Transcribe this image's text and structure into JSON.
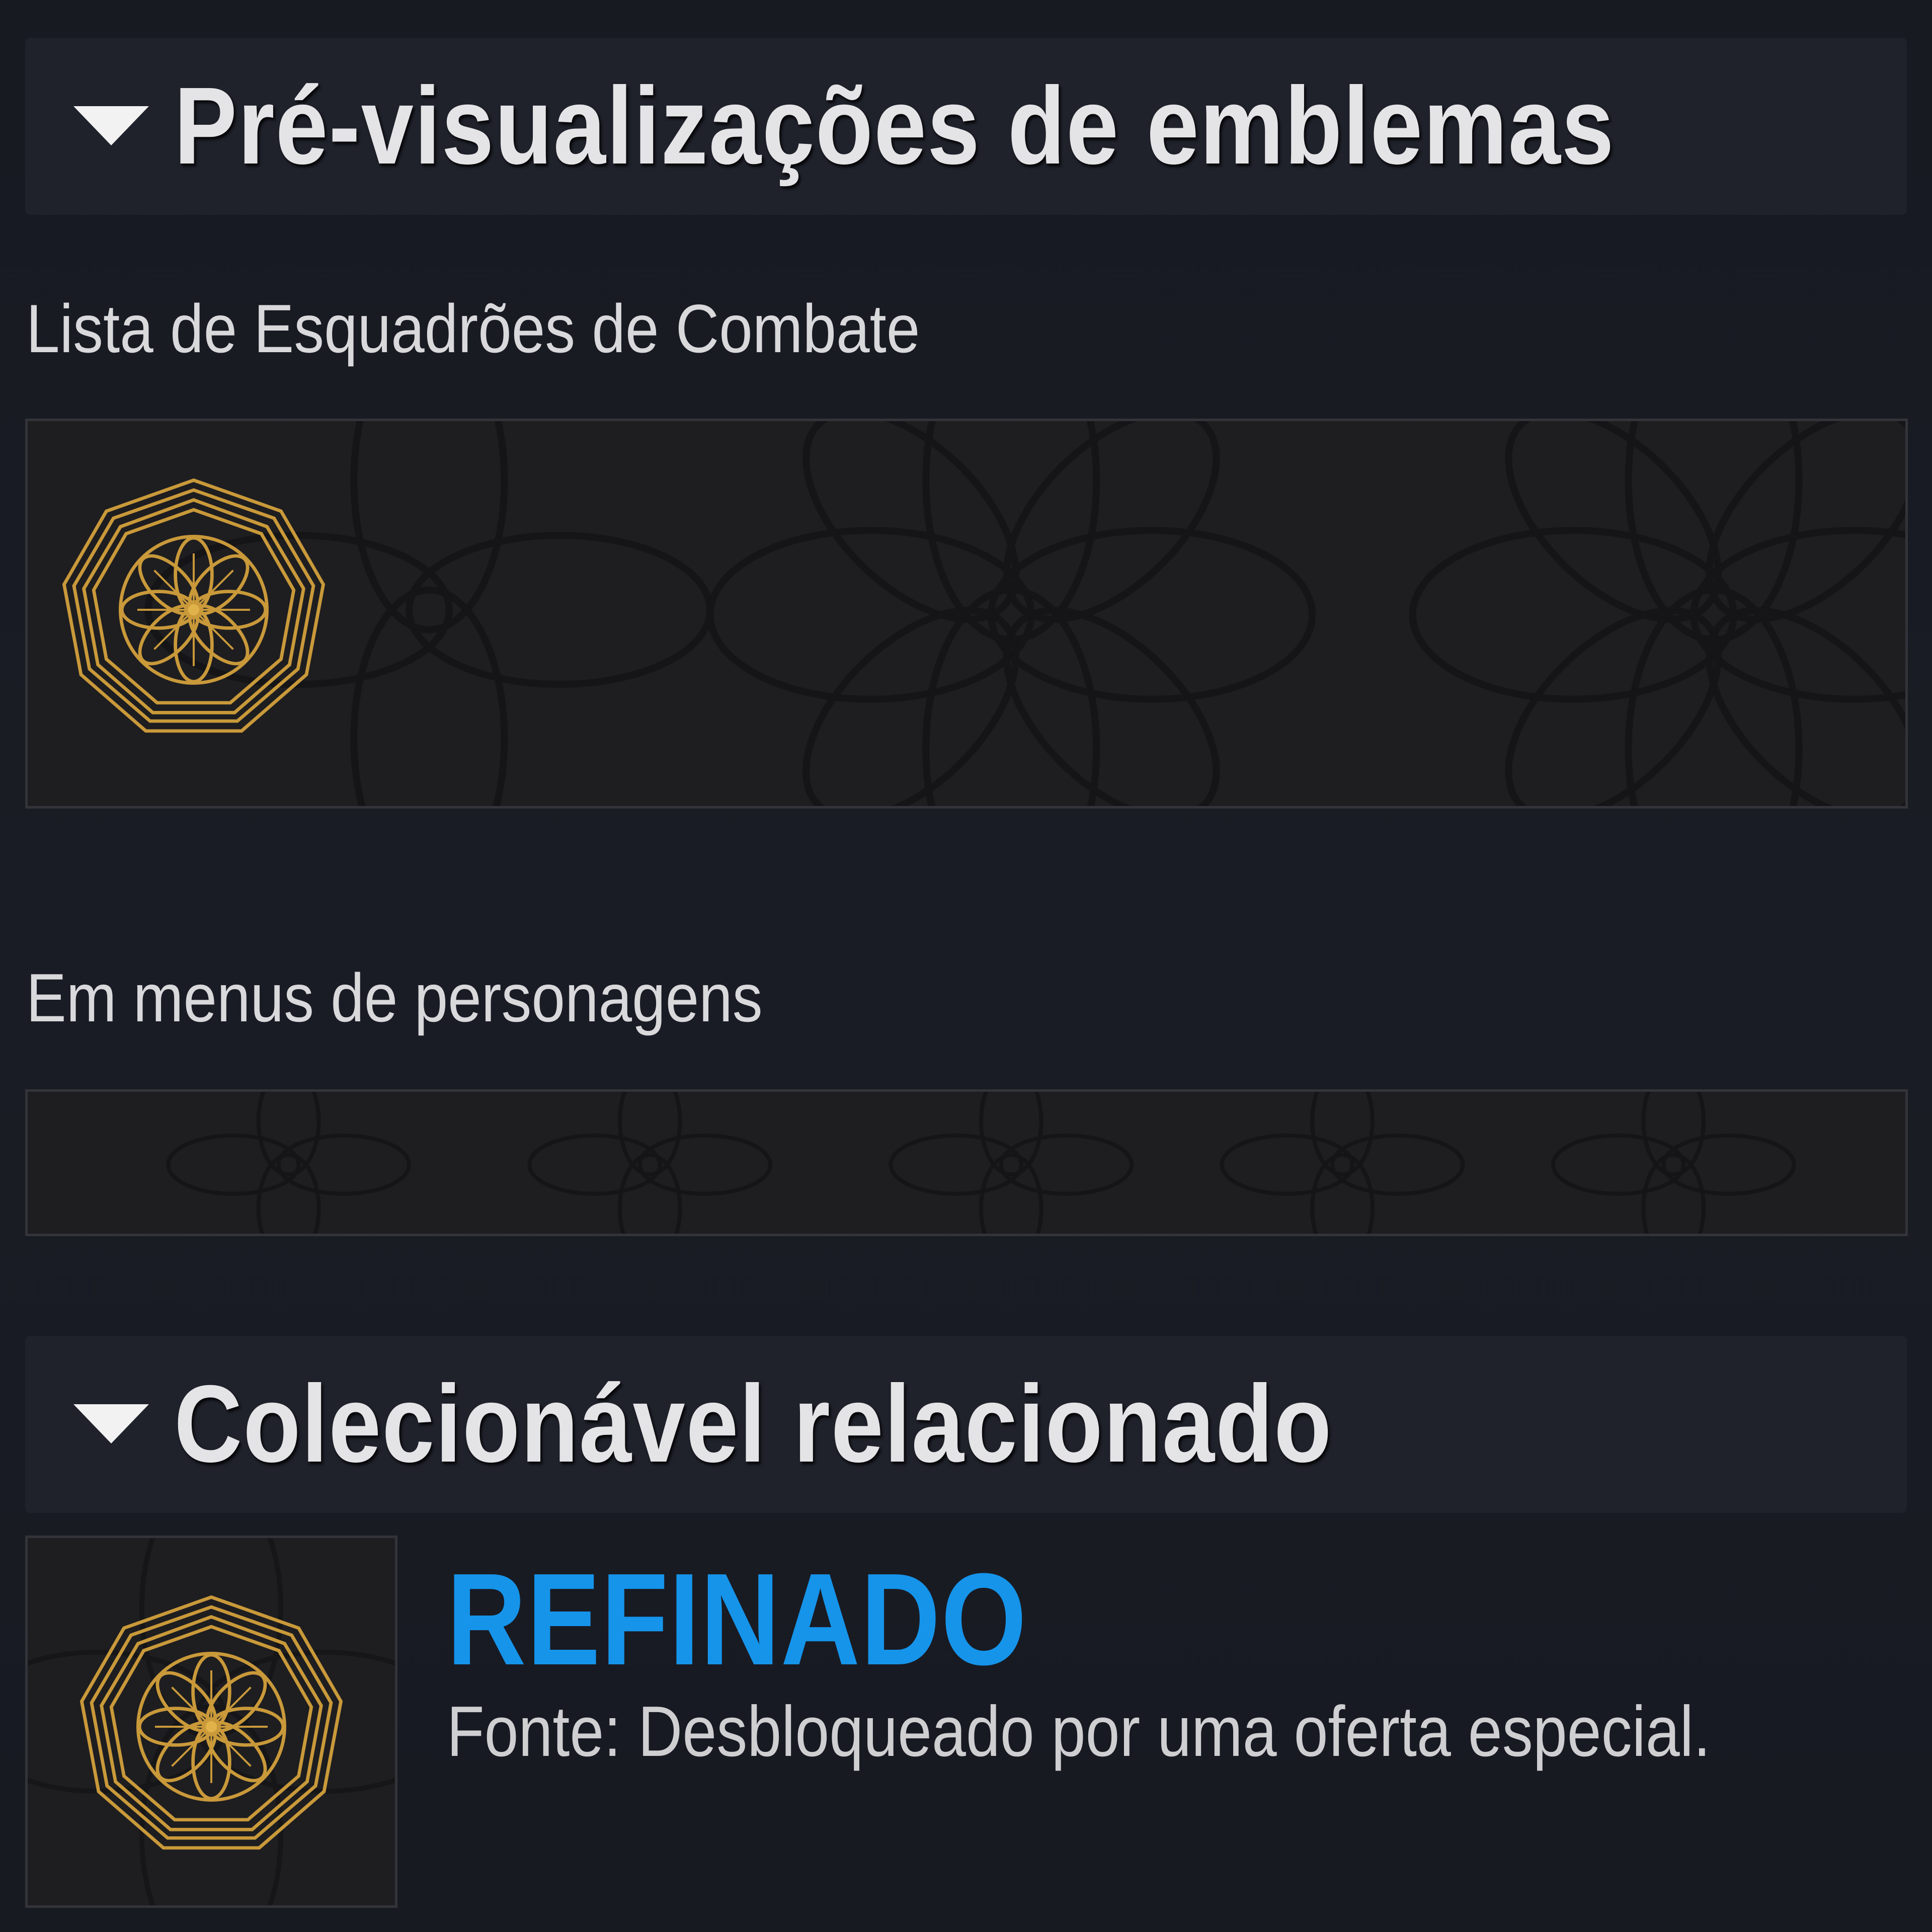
{
  "sections": {
    "emblem_previews": {
      "title": "Pré-visualizações de emblemas",
      "caret_icon": "caret-down-icon",
      "fireteam_label": "Lista de Esquadrões de Combate",
      "character_menu_label": "Em menus de personagens"
    },
    "related_collectible": {
      "title": "Colecionável relacionado",
      "caret_icon": "caret-down-icon",
      "name": "REFINADO",
      "source": "Fonte: Desbloqueado por uma oferta especial.",
      "icon": "gold-flower-emblem-icon"
    }
  },
  "colors": {
    "background": "#1a1c25",
    "header_background": "#1f212b",
    "emblem_gold": "#c9993a",
    "collectible_name": "#1594ea"
  }
}
